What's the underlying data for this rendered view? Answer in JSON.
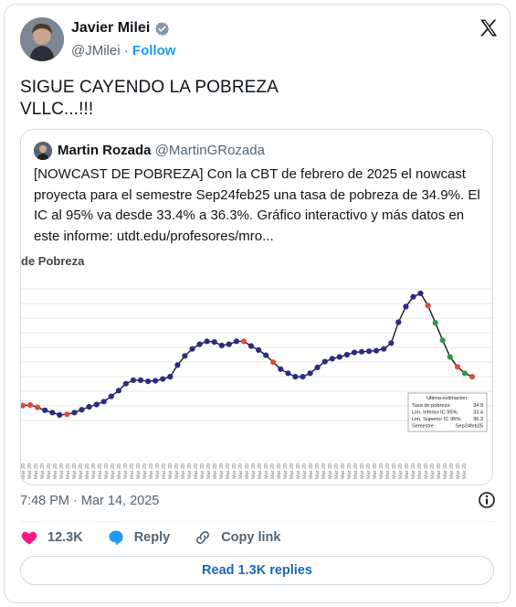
{
  "author": {
    "name": "Javier Milei",
    "handle": "@JMilei",
    "follow_label": "Follow"
  },
  "tweet": {
    "lines": [
      "SIGUE CAYENDO LA POBREZA",
      "VLLC...!!!"
    ]
  },
  "quoted": {
    "name": "Martin Rozada",
    "handle": "@MartinGRozada",
    "lines": [
      "[NOWCAST DE POBREZA] Con la CBT de febrero de 2025 el nowcast",
      "proyecta para el semestre Sep24feb25 una tasa de pobreza de 34.9%. El",
      "IC al 95%  va desde 33.4% a 36.3%. Gráfico interactivo y más datos en",
      "este informe: utdt.edu/profesores/mro..."
    ]
  },
  "chart_data": {
    "type": "line",
    "title": "de Pobreza",
    "x_note": "rotated date tick labels (illegible)",
    "values": [
      39.2,
      39.3,
      38.9,
      38.4,
      38.0,
      37.6,
      37.7,
      38.0,
      38.5,
      39.0,
      39.4,
      39.9,
      40.8,
      41.8,
      43.0,
      43.6,
      43.6,
      43.4,
      43.5,
      43.8,
      44.2,
      46.2,
      47.8,
      49.0,
      49.8,
      50.3,
      50.2,
      49.6,
      49.8,
      50.3,
      50.3,
      49.5,
      48.8,
      47.9,
      46.7,
      45.5,
      44.8,
      44.2,
      44.2,
      44.8,
      45.8,
      46.8,
      47.3,
      47.6,
      48.0,
      48.4,
      48.5,
      48.6,
      48.7,
      49.0,
      50.0,
      53.6,
      56.3,
      58.0,
      58.6,
      56.5,
      53.5,
      50.5,
      47.6,
      45.9,
      44.8,
      44.2
    ],
    "highlight_indices": [
      0,
      1,
      2,
      6,
      30,
      34,
      55,
      59,
      61
    ],
    "projection_start_index": 54,
    "colors": {
      "line": "#1a1a1a",
      "point": "#2d2a8c",
      "point_highlight": "#e34b3a",
      "projection": "#2e9b3d"
    },
    "tooltip": {
      "header": "Ultima estimacion:",
      "rows": [
        {
          "label": "Tasa de pobreza:",
          "value": "34.9"
        },
        {
          "label": "Lim. Inferior IC 95%:",
          "value": "33.4"
        },
        {
          "label": "Lim. Superior IC 95%:",
          "value": "36.3"
        },
        {
          "label": "Semestre :",
          "value": "Sep24feb25"
        }
      ]
    }
  },
  "meta": {
    "timestamp": "7:48 PM · Mar 14, 2025"
  },
  "actions": {
    "likes": "12.3K",
    "reply_label": "Reply",
    "copy_label": "Copy link"
  },
  "read_replies_label": "Read 1.3K replies",
  "colors": {
    "accent": "#1d9bf0",
    "heart": "#f91880"
  }
}
